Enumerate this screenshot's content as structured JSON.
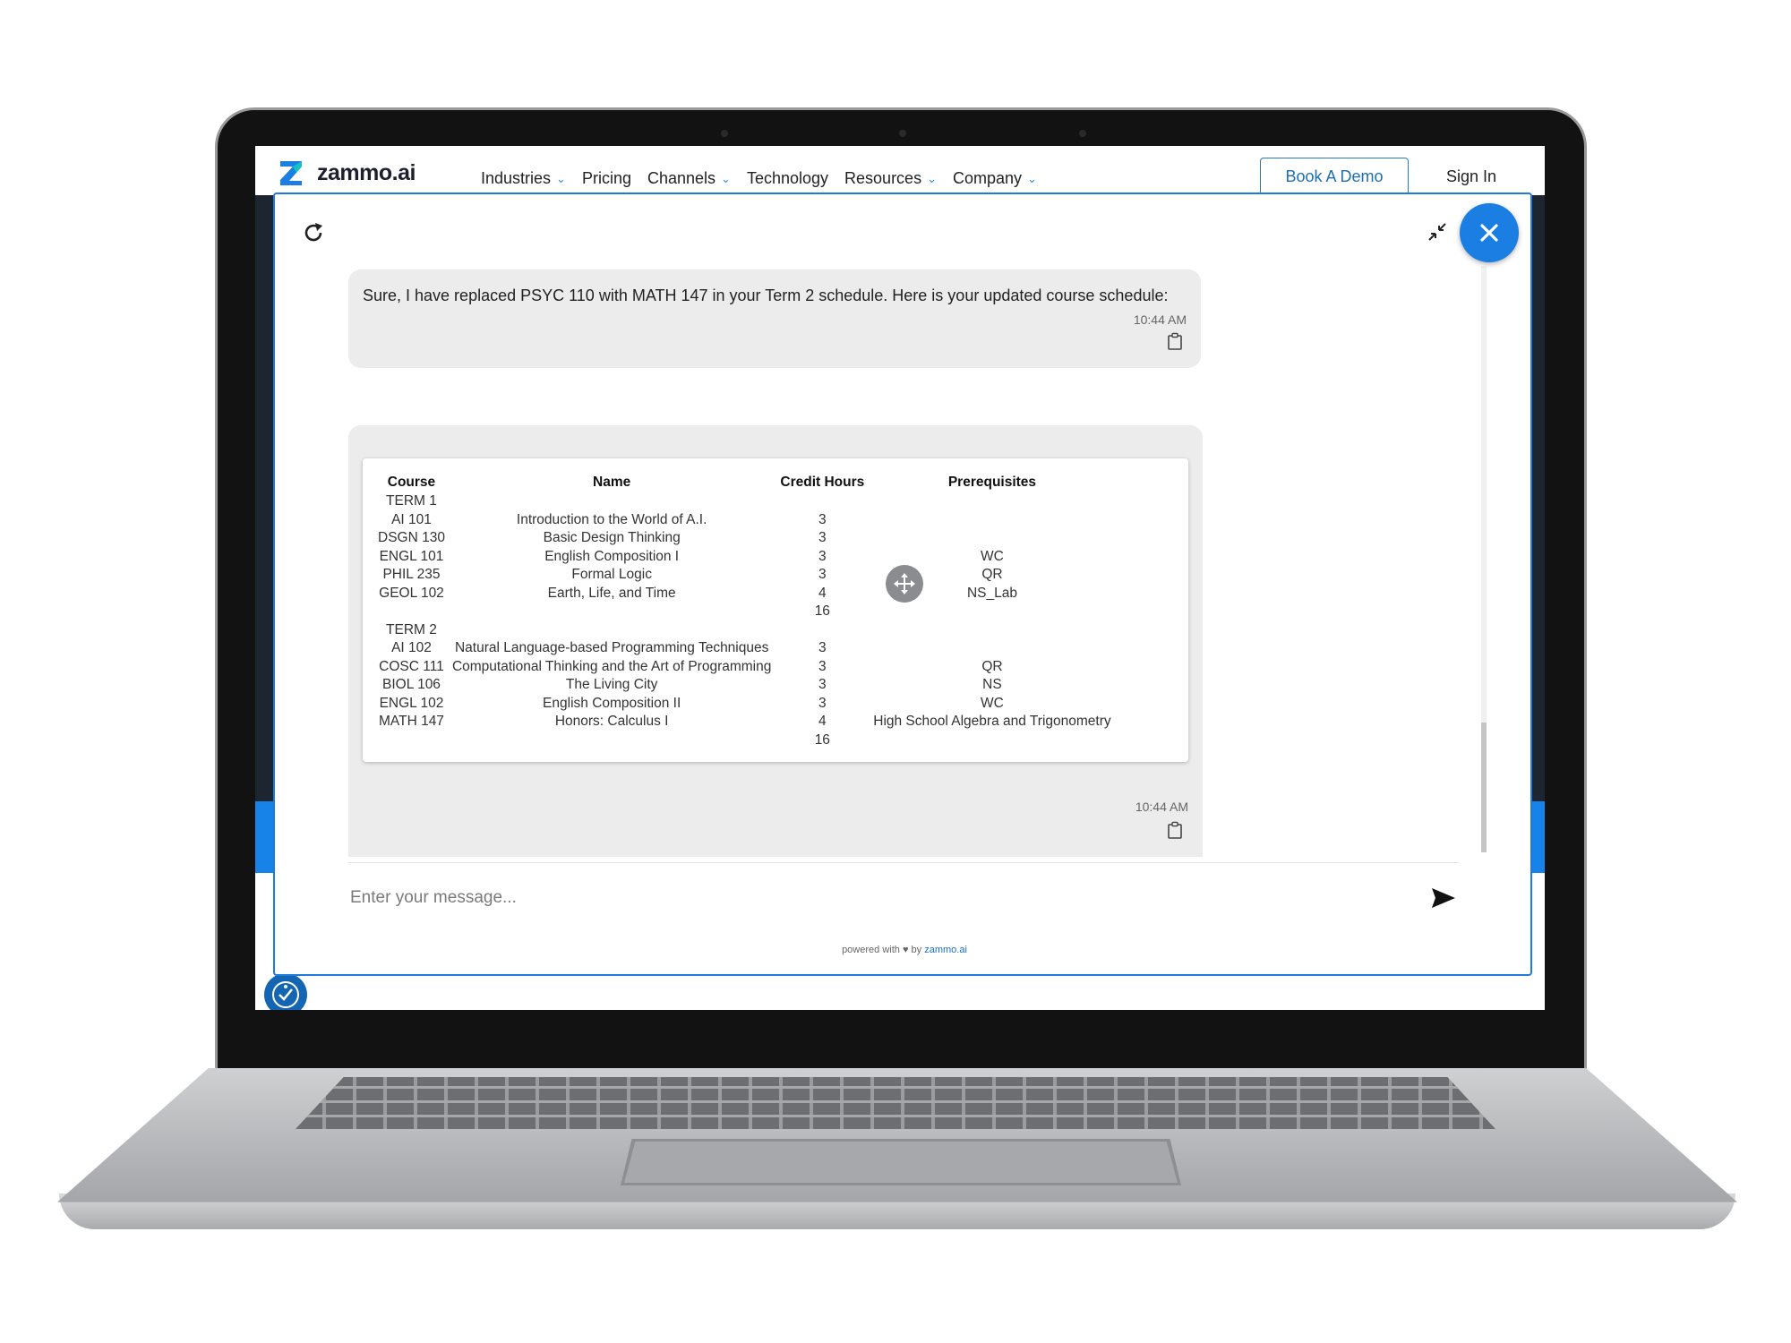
{
  "site": {
    "logo_text": "zammo.ai",
    "nav": [
      {
        "label": "Industries",
        "has_dropdown": true
      },
      {
        "label": "Pricing",
        "has_dropdown": false
      },
      {
        "label": "Channels",
        "has_dropdown": true
      },
      {
        "label": "Technology",
        "has_dropdown": false
      },
      {
        "label": "Resources",
        "has_dropdown": true
      },
      {
        "label": "Company",
        "has_dropdown": true
      }
    ],
    "book_demo": "Book A Demo",
    "sign_in": "Sign In"
  },
  "chat": {
    "message1": {
      "text": "Sure, I have replaced PSYC 110 with MATH 147 in your Term 2 schedule. Here is your updated course schedule:",
      "time": "10:44 AM"
    },
    "message2": {
      "time": "10:44 AM",
      "table": {
        "headers": [
          "Course",
          "Name",
          "Credit Hours",
          "Prerequisites"
        ],
        "rows": [
          [
            "TERM 1",
            "",
            "",
            ""
          ],
          [
            "AI 101",
            "Introduction to the World of A.I.",
            "3",
            ""
          ],
          [
            "DSGN 130",
            "Basic Design Thinking",
            "3",
            ""
          ],
          [
            "ENGL 101",
            "English Composition I",
            "3",
            "WC"
          ],
          [
            "PHIL 235",
            "Formal Logic",
            "3",
            "QR"
          ],
          [
            "GEOL 102",
            "Earth, Life, and Time",
            "4",
            "NS_Lab"
          ],
          [
            "",
            "",
            "16",
            ""
          ],
          [
            "TERM 2",
            "",
            "",
            ""
          ],
          [
            "AI 102",
            "Natural Language-based Programming Techniques",
            "3",
            ""
          ],
          [
            "COSC 111",
            "Computational Thinking and the Art of Programming",
            "3",
            "QR"
          ],
          [
            "BIOL 106",
            "The Living City",
            "3",
            "NS"
          ],
          [
            "ENGL 102",
            "English Composition II",
            "3",
            "WC"
          ],
          [
            "MATH 147",
            "Honors: Calculus I",
            "4",
            "High School Algebra and Trigonometry"
          ],
          [
            "",
            "",
            "16",
            ""
          ]
        ]
      }
    },
    "input_placeholder": "Enter your message...",
    "powered_prefix": "powered with",
    "powered_by": "by",
    "powered_brand": "zammo.ai"
  },
  "colors": {
    "accent": "#1a7ee2",
    "bubble": "#ececec",
    "laptop_bezel": "#121212"
  },
  "icons": [
    "refresh-icon",
    "minimize-icon",
    "close-icon",
    "copy-icon",
    "move-icon",
    "send-icon",
    "accessibility-icon",
    "chevron-down-icon",
    "heart-icon"
  ]
}
